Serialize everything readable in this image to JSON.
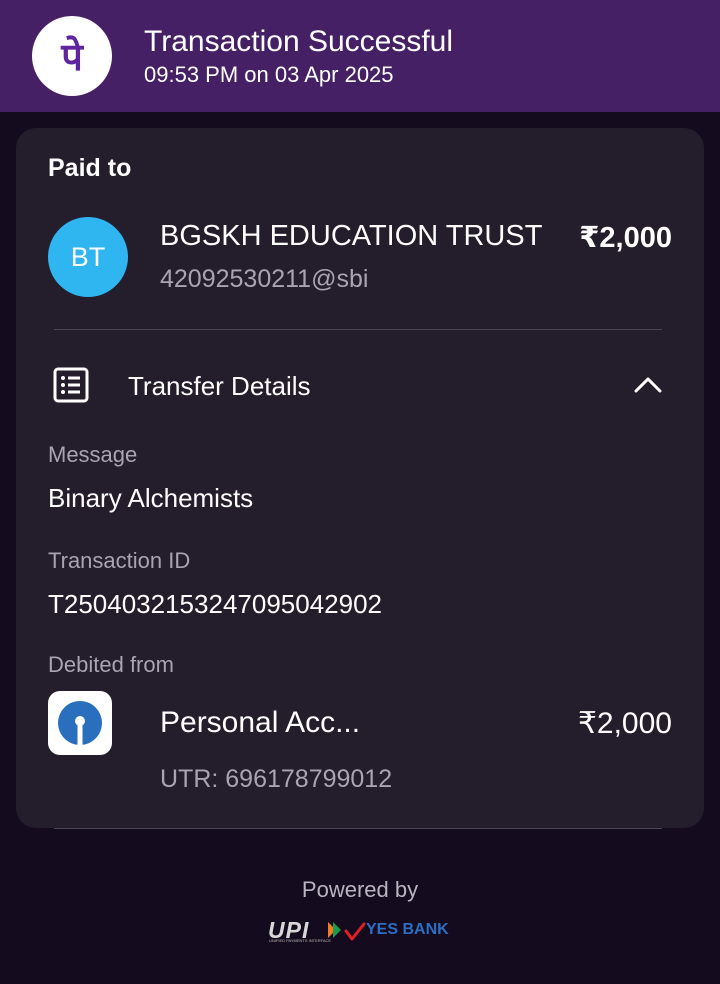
{
  "header": {
    "status_title": "Transaction Successful",
    "timestamp": "09:53 PM on 03 Apr 2025",
    "app_logo_glyph": "पे",
    "background_color": "#462065"
  },
  "payment": {
    "paid_to_label": "Paid to",
    "payee_initials": "BT",
    "payee_name": "BGSKH EDUCATION TRUST",
    "amount": "₹2,000",
    "upi_id": "42092530211@sbi",
    "avatar_color": "#2fb5ef"
  },
  "transfer_details": {
    "title": "Transfer Details",
    "icon": "receipt-list-icon",
    "toggle_icon": "chevron-up-icon",
    "message_label": "Message",
    "message_value": "Binary Alchemists",
    "transaction_id_label": "Transaction ID",
    "transaction_id_value": "T2504032153247095042902",
    "debited_from_label": "Debited from",
    "account": {
      "bank_icon": "sbi-logo-icon",
      "name": "Personal Acc...",
      "amount": "₹2,000",
      "utr": "UTR: 696178799012"
    }
  },
  "footer": {
    "powered_by": "Powered by",
    "upi_logo_text": "UPI",
    "upi_logo_subtext": "UNIFIED PAYMENTS INTERFACE",
    "bank_logo_text": "YES BANK"
  }
}
